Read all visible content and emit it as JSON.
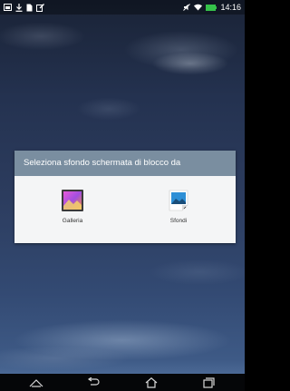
{
  "status_bar": {
    "time": "14:16",
    "left_icons": [
      "notification-image-icon",
      "download-icon",
      "document-icon",
      "edit-icon"
    ],
    "right_icons": [
      "muted-icon",
      "wifi-icon",
      "battery-icon"
    ],
    "battery_color": "#35c24a"
  },
  "dialog": {
    "title": "Seleziona sfondo schermata di blocco da",
    "header_color": "#7a8ea0",
    "options": [
      {
        "label": "Galleria",
        "icon": "gallery-icon"
      },
      {
        "label": "Sfondi",
        "icon": "wallpapers-icon"
      }
    ]
  },
  "nav_bar": {
    "buttons": [
      "recent-apps-up-icon",
      "back-icon",
      "home-icon",
      "overview-icon"
    ]
  }
}
